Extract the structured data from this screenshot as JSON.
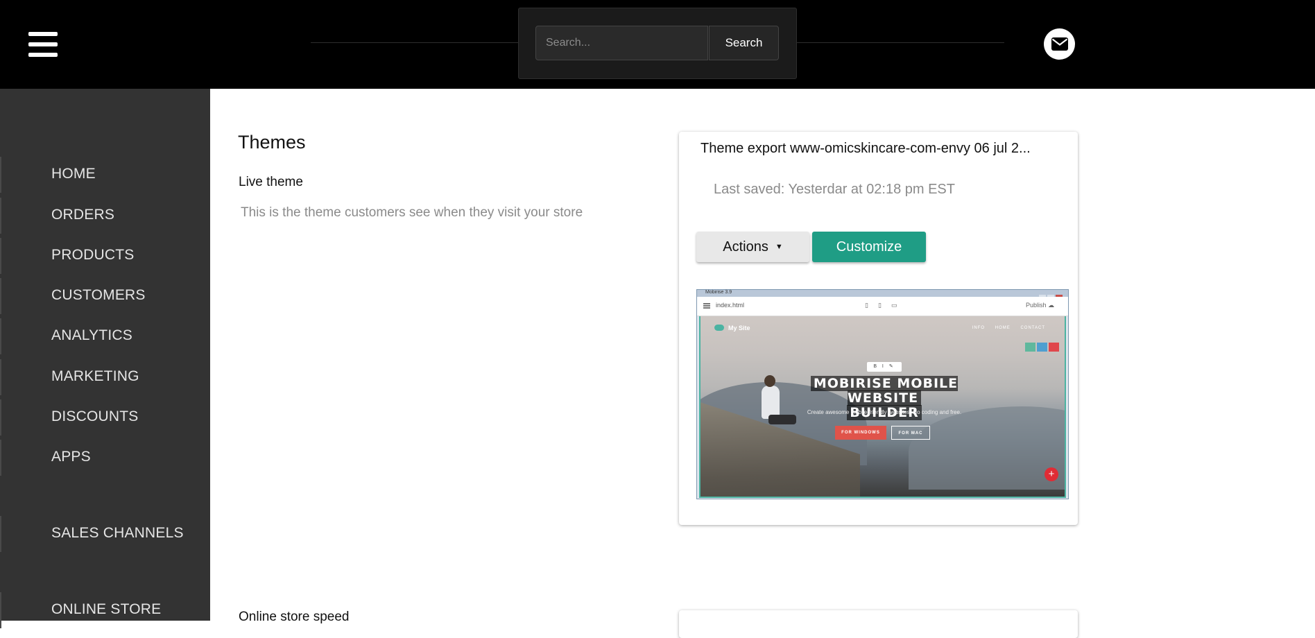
{
  "header": {
    "search_placeholder": "Search...",
    "search_button": "Search",
    "menu_icon": "hamburger-menu-icon",
    "mail_icon": "envelope-icon"
  },
  "sidebar": {
    "items": [
      {
        "label": "HOME"
      },
      {
        "label": "ORDERS"
      },
      {
        "label": "PRODUCTS"
      },
      {
        "label": "CUSTOMERS"
      },
      {
        "label": "ANALYTICS"
      },
      {
        "label": "MARKETING"
      },
      {
        "label": "DISCOUNTS"
      },
      {
        "label": "APPS"
      },
      {
        "label": "SALES CHANNELS"
      },
      {
        "label": "ONLINE STORE"
      }
    ]
  },
  "main": {
    "title": "Themes",
    "live_theme": {
      "heading": "Live theme",
      "description": "This is the theme customers see when they visit your store"
    },
    "theme_card": {
      "title": "Theme export www-omicskincare-com-envy 06 jul 2...",
      "last_saved": "Last saved: Yesterdar at 02:18 pm EST",
      "actions_button": "Actions",
      "customize_button": "Customize",
      "preview": {
        "window_title": "Mobirise 3.9",
        "file_name": "index.html",
        "publish_label": "Publish",
        "site_name": "My Site",
        "nav": [
          "INFO",
          "HOME",
          "CONTACT"
        ],
        "headline_line1": "MOBIRISE MOBILE WEBSITE",
        "headline_line2": "BUILDER",
        "subtitle": "Create awesome mobile-friendly websites. No coding and free.",
        "btn_windows": "FOR WINDOWS",
        "btn_mac": "FOR MAC",
        "mini_tools": "B I ✎"
      }
    },
    "speed_title": "Online store speed"
  },
  "colors": {
    "topbar": "#000000",
    "sidebar": "#333333",
    "accent": "#1f9d85",
    "sidebar_text": "#e6e6e6"
  }
}
